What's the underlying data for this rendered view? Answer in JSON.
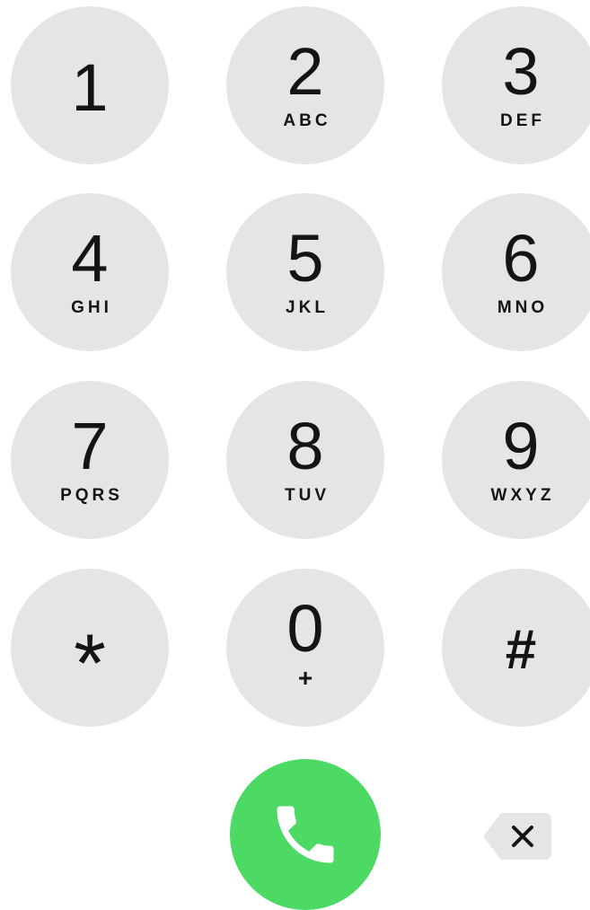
{
  "keypad": {
    "keys": [
      {
        "digit": "1",
        "letters": ""
      },
      {
        "digit": "2",
        "letters": "ABC"
      },
      {
        "digit": "3",
        "letters": "DEF"
      },
      {
        "digit": "4",
        "letters": "GHI"
      },
      {
        "digit": "5",
        "letters": "JKL"
      },
      {
        "digit": "6",
        "letters": "MNO"
      },
      {
        "digit": "7",
        "letters": "PQRS"
      },
      {
        "digit": "8",
        "letters": "TUV"
      },
      {
        "digit": "9",
        "letters": "WXYZ"
      },
      {
        "digit": "*",
        "letters": ""
      },
      {
        "digit": "0",
        "letters": "+"
      },
      {
        "digit": "#",
        "letters": ""
      }
    ]
  },
  "actions": {
    "call_icon": "phone-icon",
    "delete_icon": "backspace-icon"
  },
  "colors": {
    "key_background": "#e5e5e5",
    "key_text": "#141414",
    "call_green": "#4cd964",
    "delete_gray": "#e5e5e5"
  }
}
